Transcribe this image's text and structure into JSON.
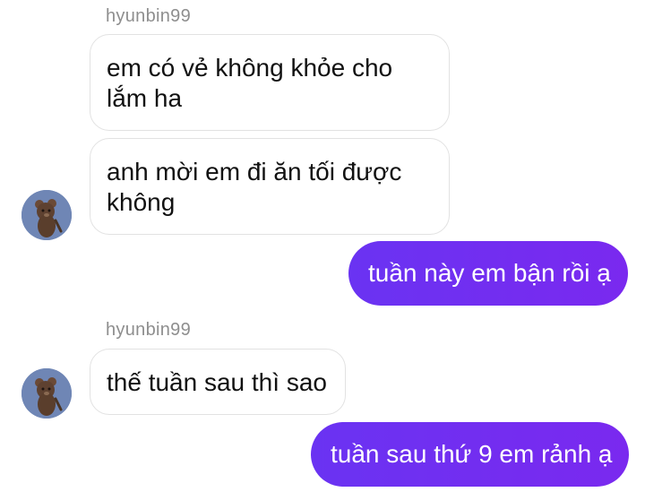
{
  "colors": {
    "outgoing_bubble": "#6f2cf5",
    "incoming_bubble": "#ffffff",
    "sender_name": "#8e8e8e"
  },
  "messages": [
    {
      "id": "m1",
      "direction": "incoming",
      "sender": "hyunbin99",
      "text": "em có vẻ không khỏe cho lắm ha"
    },
    {
      "id": "m2",
      "direction": "incoming",
      "text": "anh mời em đi ăn tối được không"
    },
    {
      "id": "m3",
      "direction": "outgoing",
      "text": "tuần này em bận rồi ạ"
    },
    {
      "id": "m4",
      "direction": "incoming",
      "sender": "hyunbin99",
      "text": "thế tuần sau thì sao"
    },
    {
      "id": "m5",
      "direction": "outgoing",
      "text": "tuần sau thứ 9 em rảnh ạ"
    }
  ],
  "avatar_icon": "teddy-bear-avatar-icon"
}
